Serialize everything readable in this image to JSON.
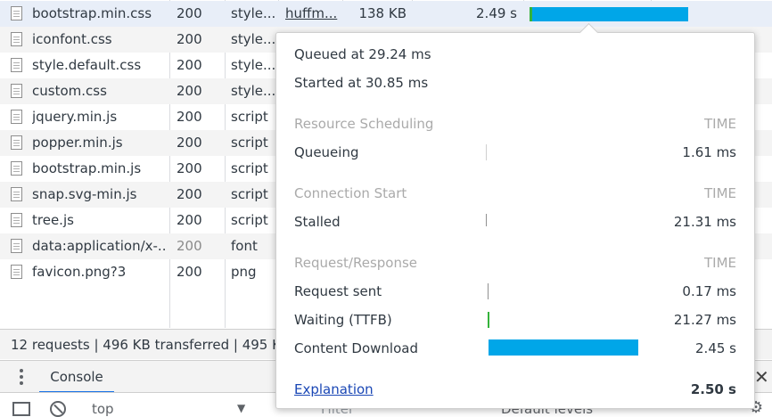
{
  "requests": [
    {
      "name": "bootstrap.min.css",
      "status": "200",
      "type": "style...",
      "initiator": "huffm...",
      "size": "138 KB",
      "time": "2.49 s",
      "selected": true
    },
    {
      "name": "iconfont.css",
      "status": "200",
      "type": "style..."
    },
    {
      "name": "style.default.css",
      "status": "200",
      "type": "style..."
    },
    {
      "name": "custom.css",
      "status": "200",
      "type": "style..."
    },
    {
      "name": "jquery.min.js",
      "status": "200",
      "type": "script"
    },
    {
      "name": "popper.min.js",
      "status": "200",
      "type": "script"
    },
    {
      "name": "bootstrap.min.js",
      "status": "200",
      "type": "script"
    },
    {
      "name": "snap.svg-min.js",
      "status": "200",
      "type": "script"
    },
    {
      "name": "tree.js",
      "status": "200",
      "type": "script"
    },
    {
      "name": "data:application/x-...",
      "status": "200",
      "type": "font",
      "muted": true
    },
    {
      "name": "favicon.png?3",
      "status": "200",
      "type": "png"
    }
  ],
  "status_bar": {
    "text": "12 requests  |  496 KB transferred  |  495 K"
  },
  "drawer": {
    "console_tab": "Console",
    "context": "top",
    "filter_placeholder": "Filter",
    "levels": "Default levels"
  },
  "timing": {
    "queued": "Queued at 29.24 ms",
    "started": "Started at 30.85 ms",
    "time_label": "TIME",
    "sections": [
      {
        "title": "Resource Scheduling",
        "rows": [
          {
            "label": "Queueing",
            "value": "1.61 ms"
          }
        ]
      },
      {
        "title": "Connection Start",
        "rows": [
          {
            "label": "Stalled",
            "value": "21.31 ms"
          }
        ]
      },
      {
        "title": "Request/Response",
        "rows": [
          {
            "label": "Request sent",
            "value": "0.17 ms"
          },
          {
            "label": "Waiting (TTFB)",
            "value": "21.27 ms"
          },
          {
            "label": "Content Download",
            "value": "2.45 s"
          }
        ]
      }
    ],
    "explanation": "Explanation",
    "total": "2.50 s"
  },
  "colors": {
    "accent": "#00a6e8",
    "ttfb": "#35b33b",
    "link": "#1a47b5"
  },
  "icons": [
    "file-icon",
    "kebab-menu-icon",
    "sidebar-toggle-icon",
    "block-icon",
    "dropdown-arrow-icon",
    "gear-icon",
    "close-icon"
  ]
}
